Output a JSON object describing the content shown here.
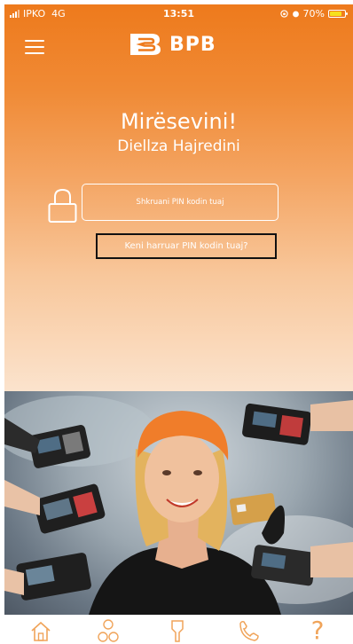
{
  "status_bar": {
    "carrier": "IPKO",
    "network": "4G",
    "time": "13:51",
    "battery": "70%"
  },
  "header": {
    "logo_text": "BPB",
    "menu_icon": "hamburger-menu-icon"
  },
  "welcome": {
    "greeting": "Mirësevini!",
    "user_name": "Diellza Hajredini"
  },
  "login": {
    "pin_placeholder": "Shkruani PIN kodin tuaj",
    "forgot_link": "Keni harruar PIN kodin tuaj?"
  },
  "bottom_nav": {
    "items": [
      {
        "icon": "home-icon"
      },
      {
        "icon": "currency-exchange-icon"
      },
      {
        "icon": "location-pin-icon"
      },
      {
        "icon": "phone-icon"
      },
      {
        "icon": "help-icon",
        "glyph": "?"
      }
    ]
  },
  "colors": {
    "brand_orange": "#ee7a1c",
    "nav_icon": "#f0a45a",
    "white": "#ffffff"
  }
}
